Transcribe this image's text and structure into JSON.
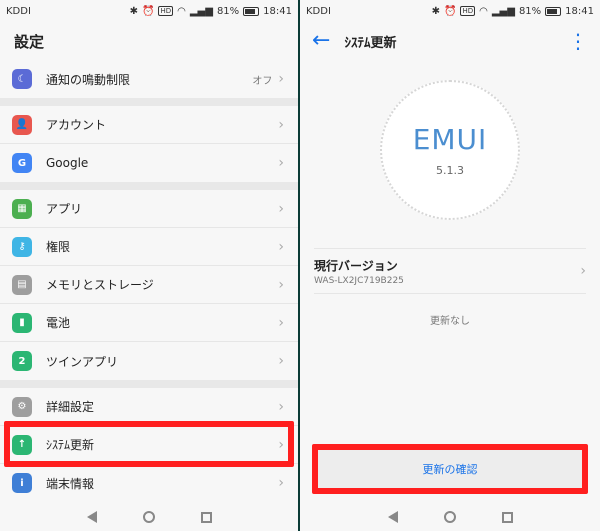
{
  "left": {
    "status": {
      "carrier": "KDDI",
      "battery_pct": "81%",
      "time": "18:41",
      "hd": "HD"
    },
    "title": "設定",
    "sections": [
      [
        {
          "label": "通知の鳴動制限",
          "value": "オフ",
          "color": "#5b6bd6",
          "icon": "moon-icon",
          "glyph": "☾"
        }
      ],
      [
        {
          "label": "アカウント",
          "color": "#e8574f",
          "icon": "user-icon",
          "glyph": "👤"
        },
        {
          "label": "Google",
          "color": "#4285f4",
          "icon": "google-icon",
          "glyph": "G"
        }
      ],
      [
        {
          "label": "アプリ",
          "color": "#4caf50",
          "icon": "apps-icon",
          "glyph": "▦"
        },
        {
          "label": "権限",
          "color": "#3fb5e5",
          "icon": "key-icon",
          "glyph": "⚷"
        },
        {
          "label": "メモリとストレージ",
          "color": "#9e9e9e",
          "icon": "storage-icon",
          "glyph": "▤"
        },
        {
          "label": "電池",
          "color": "#2bb673",
          "icon": "battery-icon",
          "glyph": "▮"
        },
        {
          "label": "ツインアプリ",
          "color": "#2bb673",
          "icon": "twin-app-icon",
          "glyph": "2"
        }
      ],
      [
        {
          "label": "詳細設定",
          "color": "#9e9e9e",
          "icon": "gear-icon",
          "glyph": "⚙"
        },
        {
          "label": "ｼｽﾃﾑ更新",
          "color": "#2bb673",
          "icon": "system-update-icon",
          "glyph": "↑"
        },
        {
          "label": "端末情報",
          "color": "#3f7fd6",
          "icon": "info-icon",
          "glyph": "i"
        }
      ]
    ]
  },
  "right": {
    "status": {
      "carrier": "KDDI",
      "battery_pct": "81%",
      "time": "18:41",
      "hd": "HD"
    },
    "title": "ｼｽﾃﾑ更新",
    "logo": "EMUI",
    "version": "5.1.3",
    "current_title": "現行バージョン",
    "current_build": "WAS-LX2JC719B225",
    "no_update": "更新なし",
    "check_button": "更新の確認"
  },
  "colors": {
    "highlight": "#ff1f1f",
    "accent": "#1a73e8"
  }
}
